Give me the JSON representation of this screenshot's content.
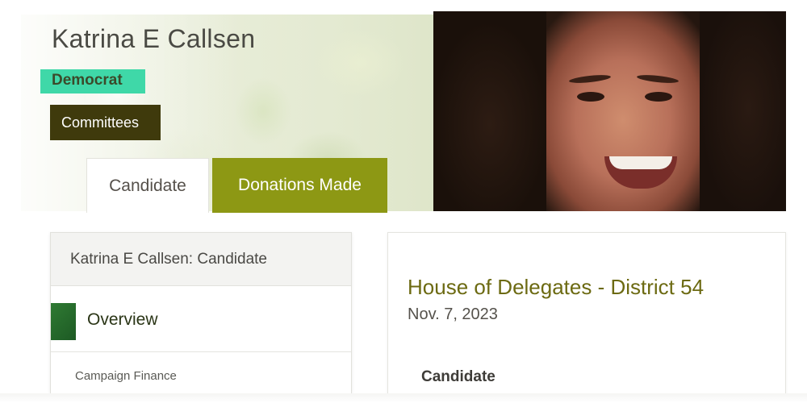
{
  "profile": {
    "name": "Katrina E Callsen",
    "party": "Democrat",
    "committees_label": "Committees"
  },
  "tabs": [
    {
      "label": "Candidate",
      "active": true
    },
    {
      "label": "Donations Made",
      "active": false
    }
  ],
  "sidebar": {
    "heading": "Katrina E Callsen: Candidate",
    "items": [
      {
        "label": "Overview",
        "active": true
      },
      {
        "label": "Campaign Finance",
        "active": false
      }
    ]
  },
  "main": {
    "race_title": "House of Delegates - District 54",
    "race_date": "Nov. 7, 2023",
    "section_label": "Candidate"
  },
  "colors": {
    "party_badge": "#3fd8a8",
    "committees_bg": "#3f3a0c",
    "donations_tab_bg": "#8d9814",
    "race_title": "#6c6a12"
  },
  "icons": {
    "overview_marker": "overview-marker-icon",
    "portrait": "candidate-portrait"
  }
}
